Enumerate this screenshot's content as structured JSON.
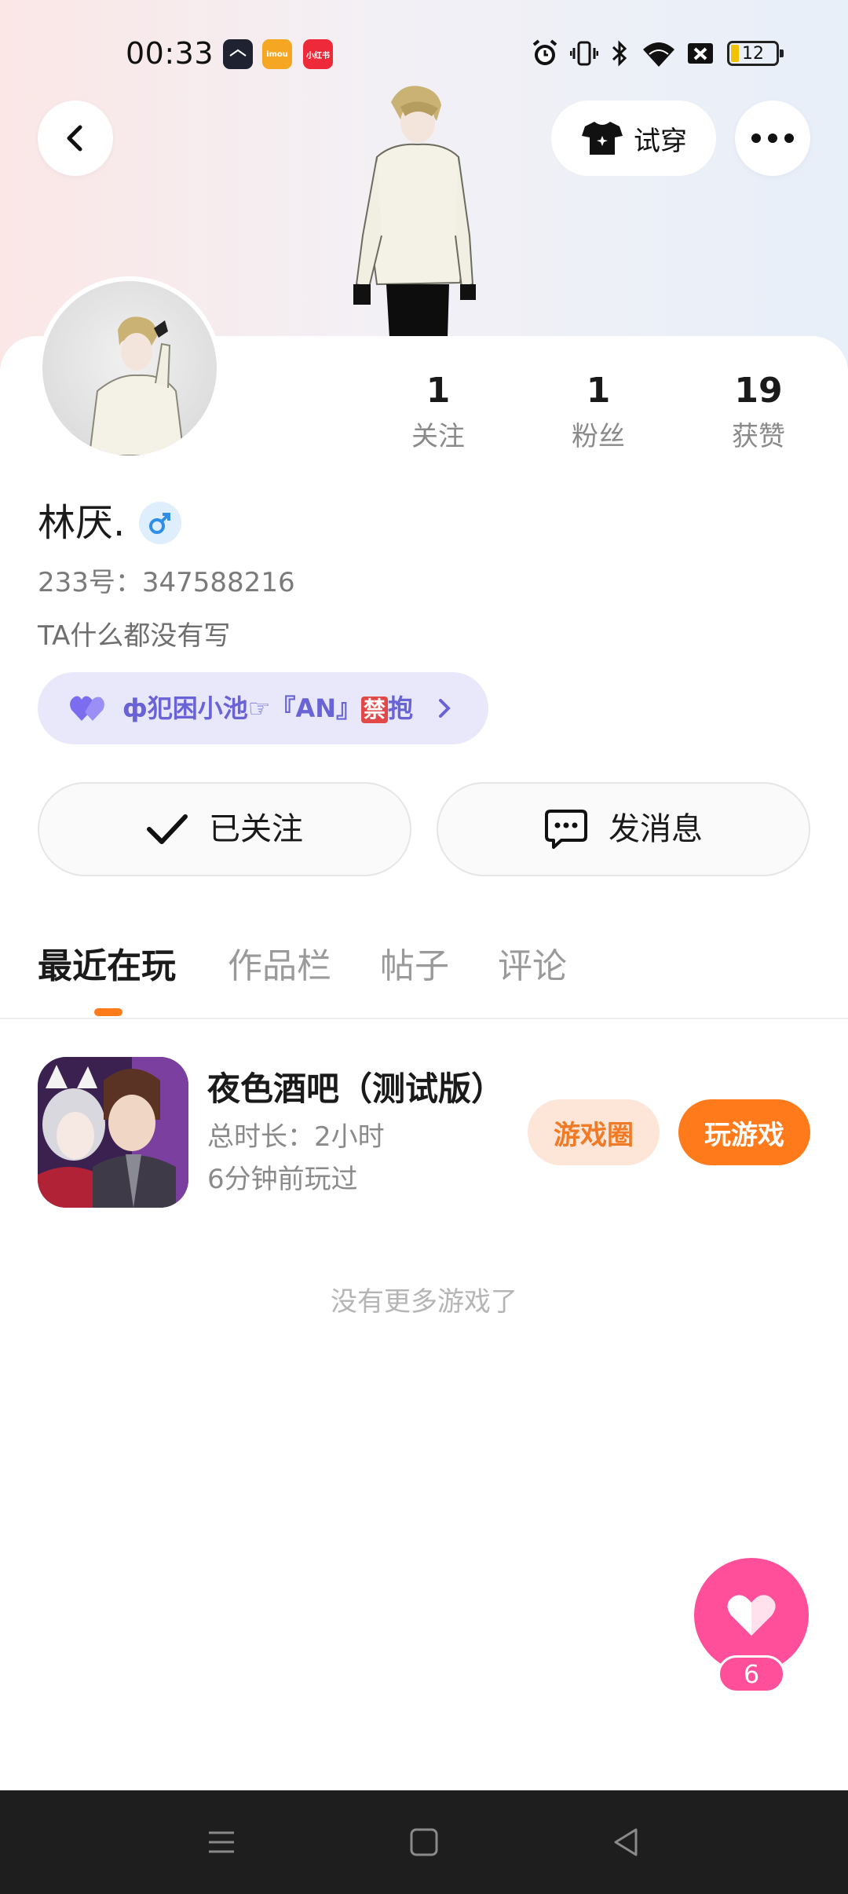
{
  "status_bar": {
    "time": "00:33",
    "app_badges": [
      {
        "name": "notes",
        "label": "",
        "color": "#1f2230"
      },
      {
        "name": "imou",
        "label": "imou",
        "color": "#f5a623"
      },
      {
        "name": "xiaohongshu",
        "label": "小红书",
        "color": "#ee2a3a"
      }
    ],
    "battery": "12"
  },
  "header": {
    "back_icon": "chevron-left-icon",
    "try_on_label": "试穿",
    "try_on_icon": "tshirt-icon",
    "more_icon": "more-dots-icon"
  },
  "profile": {
    "stats": [
      {
        "value": "1",
        "label": "关注"
      },
      {
        "value": "1",
        "label": "粉丝"
      },
      {
        "value": "19",
        "label": "获赞"
      }
    ],
    "name": "林厌.",
    "gender": "♂",
    "id_line": "233号：347588216",
    "bio": "TA什么都没有写",
    "intimacy": {
      "prefix": "ф犯困小池☞『AN』",
      "ban_char": "禁",
      "suffix": "抱",
      "heart_color": "#7b6cf0"
    }
  },
  "actions": {
    "follow_label": "已关注",
    "message_label": "发消息"
  },
  "tabs": [
    "最近在玩",
    "作品栏",
    "帖子",
    "评论"
  ],
  "games": [
    {
      "title": "夜色酒吧（测试版）",
      "duration": "总时长：2小时",
      "last_played": "6分钟前玩过",
      "circle_label": "游戏圈",
      "play_label": "玩游戏"
    }
  ],
  "no_more_text": "没有更多游戏了",
  "fab": {
    "icon": "heart-icon",
    "count": "6"
  },
  "colors": {
    "accent": "#ff7a1a",
    "pink": "#ff4f9a",
    "intimacy_bg": "#e9e8fb"
  }
}
